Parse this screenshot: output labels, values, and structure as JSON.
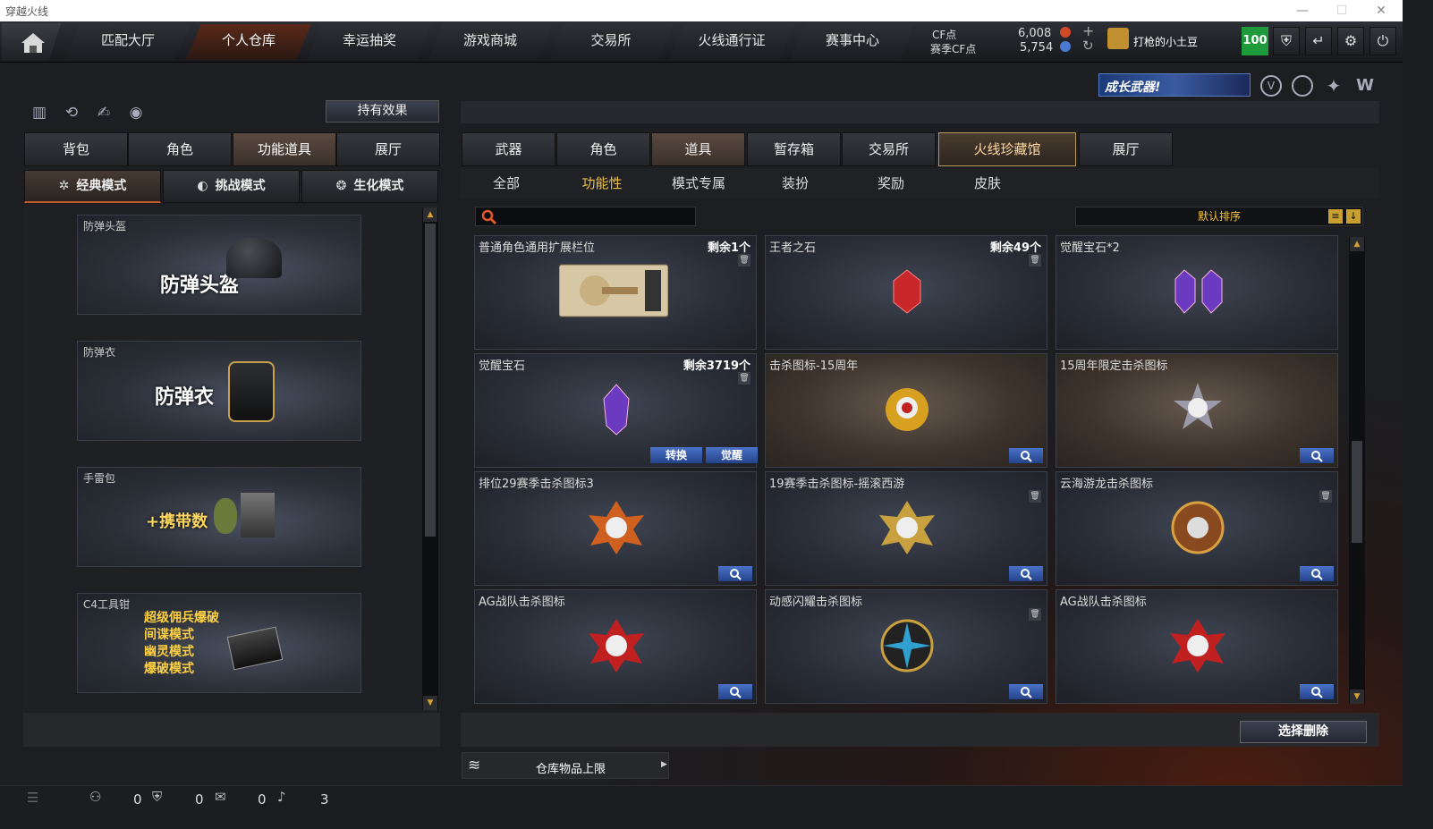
{
  "window": {
    "title": "穿越火线",
    "minimize": "—",
    "maximize": "☐",
    "close": "✕"
  },
  "nav": {
    "tabs": [
      "匹配大厅",
      "个人仓库",
      "幸运抽奖",
      "游戏商城",
      "交易所",
      "火线通行证",
      "赛事中心"
    ],
    "active": 1
  },
  "currency": {
    "cf_label": "CF点",
    "cf_value": "6,008",
    "season_label": "赛季CF点",
    "season_value": "5,754"
  },
  "user": {
    "name": "打枪的小土豆",
    "level": "100"
  },
  "promo_text": "成长武器!",
  "left": {
    "hold_effect": "持有效果",
    "tabs": [
      "背包",
      "角色",
      "功能道具",
      "展厅"
    ],
    "active_tab": 2,
    "modes": [
      "经典模式",
      "挑战模式",
      "生化模式"
    ],
    "active_mode": 0,
    "cards": [
      {
        "label": "防弹头盔",
        "big": "防弹头盔"
      },
      {
        "label": "防弹衣",
        "big": "防弹衣"
      },
      {
        "label": "手雷包",
        "big": "+携带数"
      },
      {
        "label": "C4工具钳",
        "lines": [
          "超级佣兵爆破",
          "间谍模式",
          "幽灵模式",
          "爆破模式"
        ]
      }
    ]
  },
  "right": {
    "tabs": [
      "武器",
      "角色",
      "道具",
      "暂存箱",
      "交易所",
      "火线珍藏馆",
      "展厅"
    ],
    "active_tab": 2,
    "gold_tab": 5,
    "subtabs": [
      "全部",
      "功能性",
      "模式专属",
      "装扮",
      "奖励",
      "皮肤"
    ],
    "active_sub": 1,
    "search": {
      "placeholder": ""
    },
    "sort": "默认排序",
    "items": [
      {
        "name": "普通角色通用扩展栏位",
        "remain": "剩余1个",
        "trash": true
      },
      {
        "name": "王者之石",
        "remain": "剩余49个",
        "trash": true
      },
      {
        "name": "觉醒宝石*2",
        "remain": ""
      },
      {
        "name": "觉醒宝石",
        "remain": "剩余3719个",
        "trash": true,
        "buttons": [
          "转换",
          "觉醒"
        ]
      },
      {
        "name": "击杀图标-15周年",
        "remain": "",
        "brown": true,
        "mag": true
      },
      {
        "name": "15周年限定击杀图标",
        "remain": "",
        "brown": true,
        "mag": true
      },
      {
        "name": "排位29赛季击杀图标3",
        "remain": "",
        "mag": true
      },
      {
        "name": "19赛季击杀图标-摇滚西游",
        "remain": "",
        "trash": true,
        "mag": true
      },
      {
        "name": "云海游龙击杀图标",
        "remain": "",
        "trash": true,
        "mag": true
      },
      {
        "name": "AG战队击杀图标",
        "remain": "",
        "mag": true
      },
      {
        "name": "动感闪耀击杀图标",
        "remain": "",
        "trash": true,
        "mag": true
      },
      {
        "name": "AG战队击杀图标",
        "remain": "",
        "mag": true
      }
    ],
    "select_delete": "选择删除",
    "capacity": "仓库物品上限"
  },
  "status": {
    "count1": "0",
    "count2": "0",
    "count3": "0",
    "count4": "3"
  },
  "icons": [
    "home-icon",
    "shield-icon",
    "exit-icon",
    "settings-icon",
    "power-icon",
    "search-icon",
    "trash-icon",
    "magnify-icon"
  ]
}
